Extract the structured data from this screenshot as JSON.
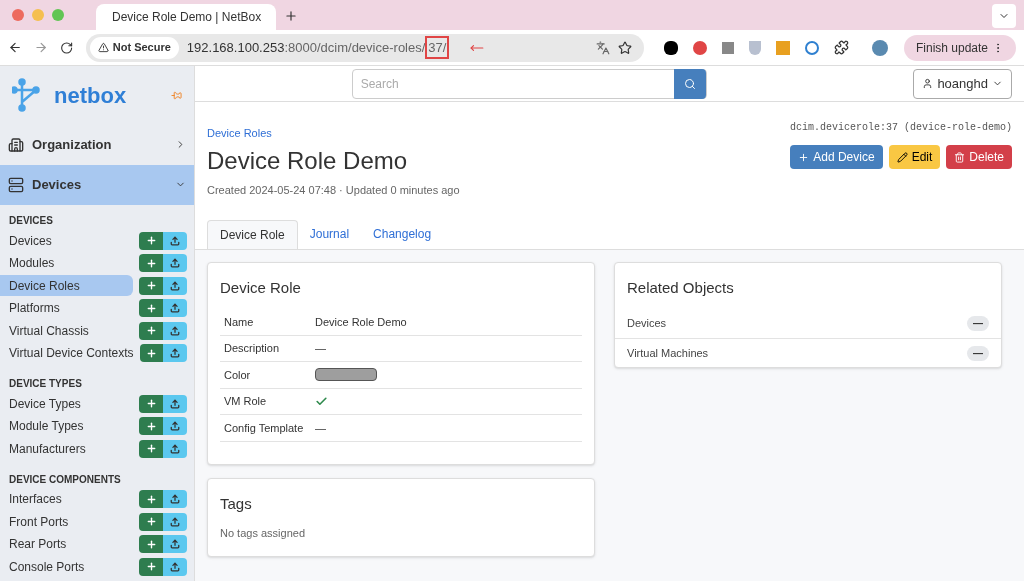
{
  "browser": {
    "tab_title": "Device Role Demo | NetBox",
    "security": "Not Secure",
    "url_host": "192.168.100.253",
    "url_path": ":8000/dcim/device-roles/",
    "url_marked": "37/",
    "update_button": "Finish update"
  },
  "sidebar": {
    "logo": "netbox",
    "menus": [
      {
        "label": "Organization",
        "expanded": false
      },
      {
        "label": "Devices",
        "expanded": true
      }
    ],
    "sections": [
      {
        "heading": "DEVICES",
        "items": [
          {
            "label": "Devices",
            "selected": false
          },
          {
            "label": "Modules",
            "selected": false
          },
          {
            "label": "Device Roles",
            "selected": true
          },
          {
            "label": "Platforms",
            "selected": false
          },
          {
            "label": "Virtual Chassis",
            "selected": false
          },
          {
            "label": "Virtual Device Contexts",
            "selected": false
          }
        ]
      },
      {
        "heading": "DEVICE TYPES",
        "items": [
          {
            "label": "Device Types",
            "selected": false
          },
          {
            "label": "Module Types",
            "selected": false
          },
          {
            "label": "Manufacturers",
            "selected": false
          }
        ]
      },
      {
        "heading": "DEVICE COMPONENTS",
        "items": [
          {
            "label": "Interfaces",
            "selected": false
          },
          {
            "label": "Front Ports",
            "selected": false
          },
          {
            "label": "Rear Ports",
            "selected": false
          },
          {
            "label": "Console Ports",
            "selected": false
          }
        ]
      }
    ]
  },
  "topbar": {
    "search_placeholder": "Search",
    "user": "hoanghd"
  },
  "header": {
    "breadcrumb": "Device Roles",
    "object_id": "dcim.devicerole:37 (device-role-demo)",
    "title": "Device Role Demo",
    "meta": "Created 2024-05-24 07:48 · Updated 0 minutes ago",
    "buttons": [
      {
        "label": "Add Device",
        "kind": "add"
      },
      {
        "label": "Edit",
        "kind": "edit"
      },
      {
        "label": "Delete",
        "kind": "delete"
      }
    ]
  },
  "tabs": [
    {
      "label": "Device Role",
      "selected": true
    },
    {
      "label": "Journal",
      "selected": false
    },
    {
      "label": "Changelog",
      "selected": false
    }
  ],
  "details": {
    "title": "Device Role",
    "rows": [
      {
        "label": "Name",
        "kind": "text",
        "value": "Device Role Demo"
      },
      {
        "label": "Description",
        "kind": "text",
        "value": "—"
      },
      {
        "label": "Color",
        "kind": "color",
        "color": "#9e9e9e"
      },
      {
        "label": "VM Role",
        "kind": "boolean",
        "checked": true
      },
      {
        "label": "Config Template",
        "kind": "text",
        "value": "—"
      }
    ]
  },
  "tags": {
    "title": "Tags",
    "empty": "No tags assigned"
  },
  "related": {
    "title": "Related Objects",
    "rows": [
      {
        "label": "Devices",
        "count": "—"
      },
      {
        "label": "Virtual Machines",
        "count": "—"
      }
    ]
  }
}
